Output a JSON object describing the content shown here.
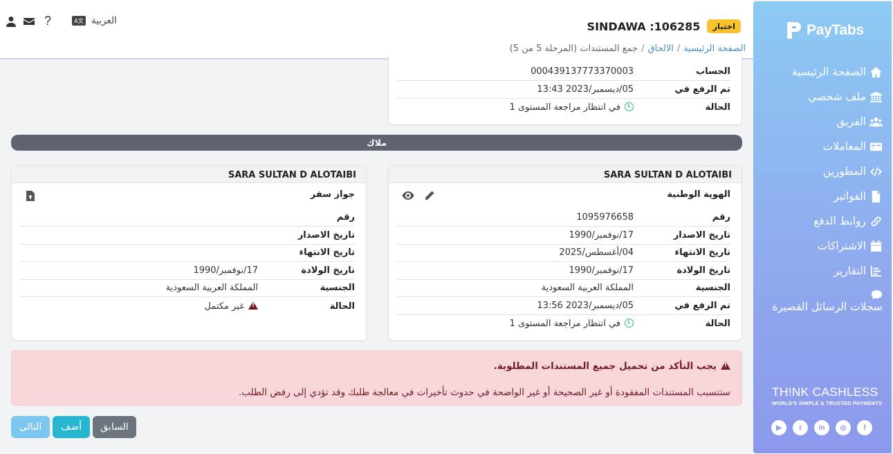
{
  "brand": {
    "name": "PayTabs",
    "tagline_main": "TH!NK CASHLESS",
    "tagline_sub": "WORLD'S SIMPLE & TRUSTED PAYMENTS",
    "sidebar_colors": [
      "#8ccaf3",
      "#8c98ec"
    ]
  },
  "nav": [
    {
      "label": "الصفحة الرئيسية",
      "icon": "home-icon"
    },
    {
      "label": "ملف شخصي",
      "icon": "bank-icon"
    },
    {
      "label": "الفريق",
      "icon": "users-icon"
    },
    {
      "label": "المعاملات",
      "icon": "card-icon"
    },
    {
      "label": "المطورين",
      "icon": "code-icon"
    },
    {
      "label": "الفواتير",
      "icon": "file-icon"
    },
    {
      "label": "روابط الدفع",
      "icon": "link-icon"
    },
    {
      "label": "الاشتراكات",
      "icon": "calendar-icon"
    },
    {
      "label": "التقارير",
      "icon": "report-icon"
    },
    {
      "label": "سجلات الرسائل القصيرة",
      "icon": "sms-icon"
    }
  ],
  "header": {
    "language": "العربية",
    "badge": "اختبار",
    "account": "SINDAWA :106285"
  },
  "breadcrumb": {
    "home": "الصفحة الرئيسية",
    "onboarding": "الالحاق",
    "current": "جمع المستندات (المرحلة 5 من 5)"
  },
  "top_card": {
    "rows": [
      {
        "key": "الحساب",
        "value": "000439137773370003"
      },
      {
        "key": "تم الرفع في",
        "value": "05/ديسمبر/2023 13:43"
      },
      {
        "key": "الحالة",
        "value": "في انتظار مراجعة المستوى 1"
      }
    ]
  },
  "owners_label": "ملاك",
  "card_right": {
    "name": "SARA SULTAN D ALOTAIBI",
    "doc": "الهوية الوطنية",
    "rows": [
      {
        "key": "رقم",
        "value": "1095976658"
      },
      {
        "key": "تاريخ الاصدار",
        "value": "17/نوفمبر/1990"
      },
      {
        "key": "تاريخ الانتهاء",
        "value": "04/أغسطس/2025"
      },
      {
        "key": "تاريخ الولادة",
        "value": "17/نوفمبر/1990"
      },
      {
        "key": "الجنسية",
        "value": "المملكة العربية السعودية"
      },
      {
        "key": "تم الرفع في",
        "value": "05/ديسمبر/2023 13:56"
      },
      {
        "key": "الحالة",
        "value": "في انتظار مراجعة المستوى 1"
      }
    ]
  },
  "card_left": {
    "name": "SARA SULTAN D ALOTAIBI",
    "doc": "جواز سفر",
    "rows": [
      {
        "key": "رقم",
        "value": ""
      },
      {
        "key": "تاريخ الاصدار",
        "value": ""
      },
      {
        "key": "تاريخ الانتهاء",
        "value": ""
      },
      {
        "key": "تاريخ الولادة",
        "value": "17/نوفمبر/1990"
      },
      {
        "key": "الجنسية",
        "value": "المملكة العربية السعودية"
      },
      {
        "key": "الحالة",
        "value": "غير مكتمل"
      }
    ]
  },
  "alert": {
    "title": "يجب التأكد من تحميل جميع المستندات المطلوبة.",
    "body": "ستتسبب المستندات المفقودة أو غير الصحيحة أو غير الواضحة في حدوث تأخيرات في معالجة طلبك وقد تؤدي إلى رفض الطلب."
  },
  "buttons": {
    "next": "التالى",
    "add": "أضف",
    "prev": "السابق"
  },
  "colors": {
    "badge": "#f7c22c",
    "owners_bar": "#5f6270",
    "alert_bg": "#f8d7da",
    "btn_next": "#7cc6f0",
    "btn_add": "#27b6cf",
    "btn_prev": "#6c757d",
    "status_ok": "#2dba6c",
    "status_warn": "#6d1b1b"
  },
  "social": [
    "youtube-icon",
    "twitter-icon",
    "linkedin-icon",
    "instagram-icon",
    "facebook-icon"
  ]
}
